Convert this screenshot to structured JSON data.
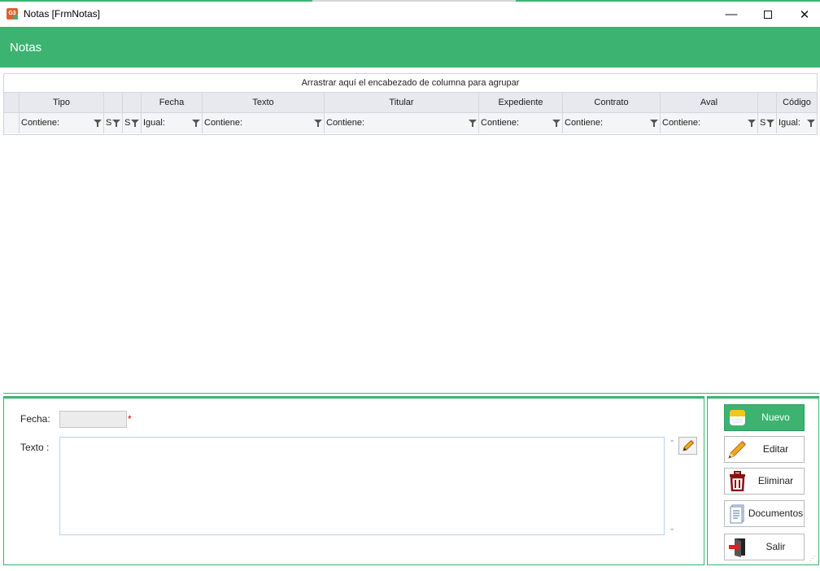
{
  "window": {
    "title": "Notas [FrmNotas]",
    "app_icon_text": "G3",
    "minimize_glyph": "—",
    "close_glyph": "✕"
  },
  "header": {
    "title": "Notas"
  },
  "colors": {
    "accent": "#3cb371",
    "required": "#d20000"
  },
  "grid": {
    "group_panel_text": "Arrastrar aquí el encabezado de columna para agrupar",
    "columns": [
      {
        "header": "",
        "filter": ""
      },
      {
        "header": "Tipo",
        "filter": "Contiene:"
      },
      {
        "header": "",
        "filter": "S"
      },
      {
        "header": "",
        "filter": "S"
      },
      {
        "header": "Fecha",
        "filter": "Igual:"
      },
      {
        "header": "Texto",
        "filter": "Contiene:"
      },
      {
        "header": "Titular",
        "filter": "Contiene:"
      },
      {
        "header": "Expediente",
        "filter": "Contiene:"
      },
      {
        "header": "Contrato",
        "filter": "Contiene:"
      },
      {
        "header": "Aval",
        "filter": "Contiene:"
      },
      {
        "header": "",
        "filter": "S"
      },
      {
        "header": "Código",
        "filter": "Igual:"
      }
    ]
  },
  "detail": {
    "fecha_label": "Fecha:",
    "fecha_value": "",
    "required_mark": "*",
    "texto_label": "Texto :",
    "texto_value": "",
    "scroll_up": "⌃",
    "scroll_down": "⌄"
  },
  "actions": {
    "nuevo": {
      "label": "Nuevo",
      "icon": "notepad-icon"
    },
    "editar": {
      "label": "Editar",
      "icon": "pencil-icon"
    },
    "eliminar": {
      "label": "Eliminar",
      "icon": "trash-icon"
    },
    "documentos": {
      "label": "Documentos",
      "icon": "document-icon"
    },
    "salir": {
      "label": "Salir",
      "icon": "exit-door-icon"
    }
  }
}
